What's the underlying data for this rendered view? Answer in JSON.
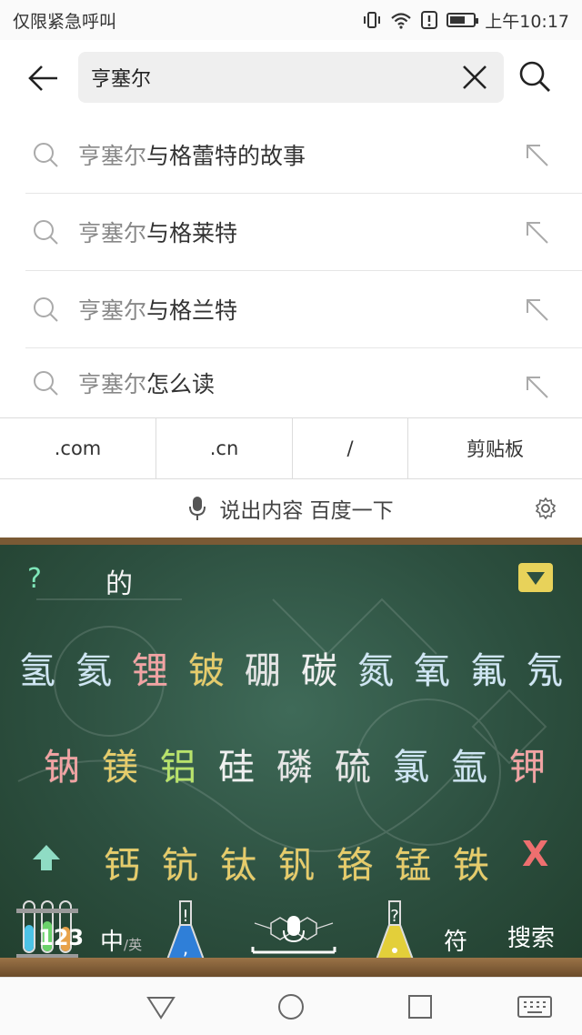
{
  "status_bar": {
    "left_text": "仅限紧急呼叫",
    "time": "上午10:17",
    "icons": [
      "vibrate-icon",
      "wifi-icon",
      "alert-icon",
      "battery-icon"
    ]
  },
  "search": {
    "query": "亨塞尔",
    "back_icon": "back-arrow-icon",
    "clear_icon": "close-icon",
    "submit_icon": "search-icon"
  },
  "suggestions": [
    {
      "query": "亨塞尔",
      "rest": "与格蕾特的故事"
    },
    {
      "query": "亨塞尔",
      "rest": "与格莱特"
    },
    {
      "query": "亨塞尔",
      "rest": "与格兰特"
    },
    {
      "query": "亨塞尔",
      "rest": "怎么读"
    }
  ],
  "shortcuts": [
    ".com",
    ".cn",
    "/",
    "剪贴板"
  ],
  "voice": {
    "label": "说出内容 百度一下",
    "mic_icon": "microphone-icon",
    "settings_icon": "gear-icon"
  },
  "keyboard": {
    "theme_colors": {
      "board": "#2d5040",
      "frame": "#7a5a35"
    },
    "help_key": "?",
    "candidate": "的",
    "row1": [
      "氢",
      "氦",
      "锂",
      "铍",
      "硼",
      "碳",
      "氮",
      "氧",
      "氟",
      "氖"
    ],
    "row1_colors": [
      "#cfe6f4",
      "#cfe6f4",
      "#f2a3a3",
      "#e6cc6a",
      "#e6e6e6",
      "#f0f0f0",
      "#cfe6f4",
      "#cfe6f4",
      "#cfe6f4",
      "#cfe6f4"
    ],
    "row2": [
      "钠",
      "镁",
      "铝",
      "硅",
      "磷",
      "硫",
      "氯",
      "氩",
      "钾"
    ],
    "row2_colors": [
      "#f2a3a3",
      "#e6cc6a",
      "#b8e36a",
      "#f0f0f0",
      "#e6e6e6",
      "#e6e6e6",
      "#cfe6f4",
      "#cfe6f4",
      "#f2a3a3"
    ],
    "row3": [
      "钙",
      "钪",
      "钛",
      "钒",
      "铬",
      "锰",
      "铁"
    ],
    "row3_colors": [
      "#e6cc6a",
      "#e6cc6a",
      "#e6cc6a",
      "#e6cc6a",
      "#e6cc6a",
      "#e6cc6a",
      "#e6cc6a"
    ],
    "delete_key": "X",
    "num_key": "123",
    "lang_main": "中",
    "lang_sub": "/英",
    "sym_key": "符",
    "search_key": "搜索"
  },
  "nav_bar": {
    "icons": [
      "back-triangle-icon",
      "home-circle-icon",
      "recents-square-icon",
      "keyboard-icon"
    ]
  }
}
